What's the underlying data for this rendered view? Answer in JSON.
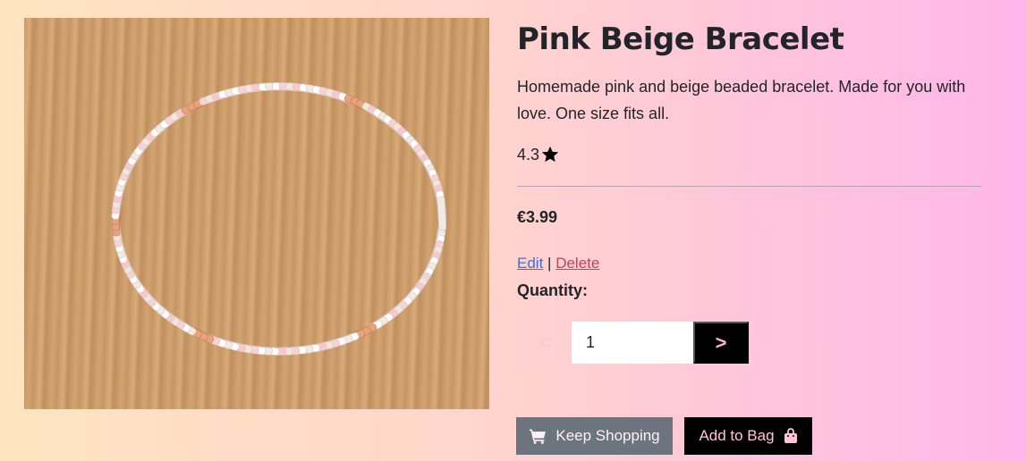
{
  "product": {
    "title": "Pink Beige Bracelet",
    "description": "Homemade pink and beige beaded bracelet. Made for you with love. One size fits all.",
    "rating": "4.3",
    "price": "€3.99",
    "image_icon": "bracelet-photo"
  },
  "admin": {
    "edit_label": "Edit",
    "separator": "|",
    "delete_label": "Delete"
  },
  "quantity": {
    "label": "Quantity:",
    "value": "1",
    "decrement_label": "<",
    "increment_label": ">"
  },
  "actions": {
    "keep_shopping_label": "Keep Shopping",
    "add_to_bag_label": "Add to Bag",
    "keep_shopping_icon": "cart-icon",
    "add_to_bag_icon": "shopping-bag-icon"
  },
  "colors": {
    "edit_link": "#3f6fd8",
    "delete_link": "#c0445a",
    "secondary_button": "#6c757d",
    "primary_button": "#000000"
  }
}
